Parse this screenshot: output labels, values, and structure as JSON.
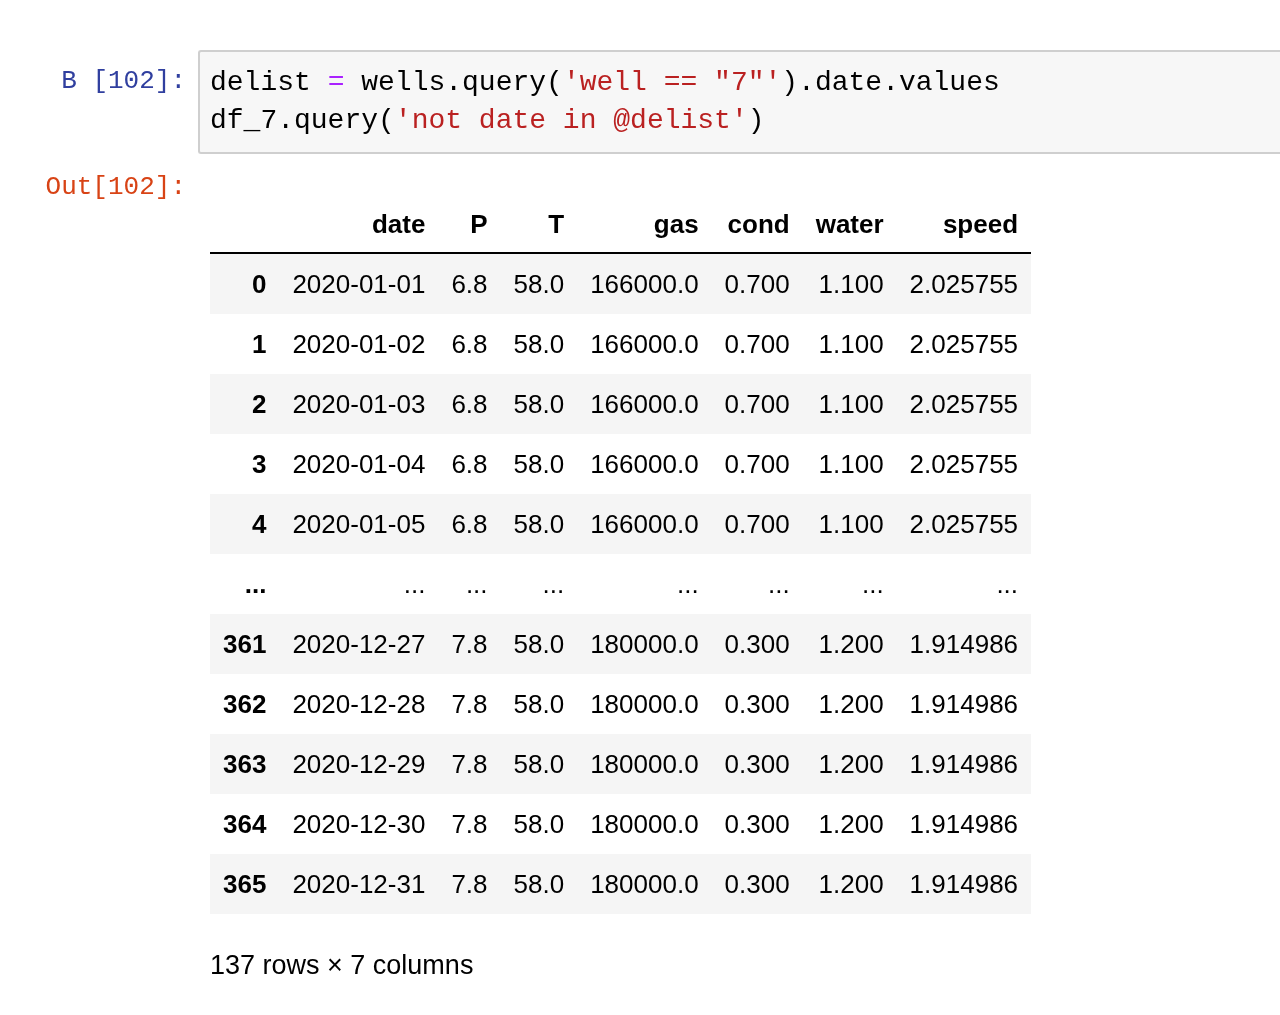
{
  "input_cell": {
    "prompt": "В [102]:",
    "lines": [
      [
        {
          "kind": "plain",
          "text": "delist "
        },
        {
          "kind": "operator",
          "text": "="
        },
        {
          "kind": "plain",
          "text": " wells.query("
        },
        {
          "kind": "string",
          "text": "'well == \"7\"'"
        },
        {
          "kind": "plain",
          "text": ").date.values"
        }
      ],
      [
        {
          "kind": "plain",
          "text": "df_7.query("
        },
        {
          "kind": "string",
          "text": "'not date in @delist'"
        },
        {
          "kind": "plain",
          "text": ")"
        }
      ]
    ]
  },
  "output_cell": {
    "prompt": "Out[102]:",
    "table": {
      "columns": [
        "date",
        "P",
        "T",
        "gas",
        "cond",
        "water",
        "speed"
      ],
      "rows": [
        {
          "index": "0",
          "cells": [
            "2020-01-01",
            "6.8",
            "58.0",
            "166000.0",
            "0.700",
            "1.100",
            "2.025755"
          ]
        },
        {
          "index": "1",
          "cells": [
            "2020-01-02",
            "6.8",
            "58.0",
            "166000.0",
            "0.700",
            "1.100",
            "2.025755"
          ]
        },
        {
          "index": "2",
          "cells": [
            "2020-01-03",
            "6.8",
            "58.0",
            "166000.0",
            "0.700",
            "1.100",
            "2.025755"
          ]
        },
        {
          "index": "3",
          "cells": [
            "2020-01-04",
            "6.8",
            "58.0",
            "166000.0",
            "0.700",
            "1.100",
            "2.025755"
          ]
        },
        {
          "index": "4",
          "cells": [
            "2020-01-05",
            "6.8",
            "58.0",
            "166000.0",
            "0.700",
            "1.100",
            "2.025755"
          ]
        },
        {
          "index": "...",
          "cells": [
            "...",
            "...",
            "...",
            "...",
            "...",
            "...",
            "..."
          ]
        },
        {
          "index": "361",
          "cells": [
            "2020-12-27",
            "7.8",
            "58.0",
            "180000.0",
            "0.300",
            "1.200",
            "1.914986"
          ]
        },
        {
          "index": "362",
          "cells": [
            "2020-12-28",
            "7.8",
            "58.0",
            "180000.0",
            "0.300",
            "1.200",
            "1.914986"
          ]
        },
        {
          "index": "363",
          "cells": [
            "2020-12-29",
            "7.8",
            "58.0",
            "180000.0",
            "0.300",
            "1.200",
            "1.914986"
          ]
        },
        {
          "index": "364",
          "cells": [
            "2020-12-30",
            "7.8",
            "58.0",
            "180000.0",
            "0.300",
            "1.200",
            "1.914986"
          ]
        },
        {
          "index": "365",
          "cells": [
            "2020-12-31",
            "7.8",
            "58.0",
            "180000.0",
            "0.300",
            "1.200",
            "1.914986"
          ]
        }
      ]
    },
    "summary": "137 rows × 7 columns"
  }
}
